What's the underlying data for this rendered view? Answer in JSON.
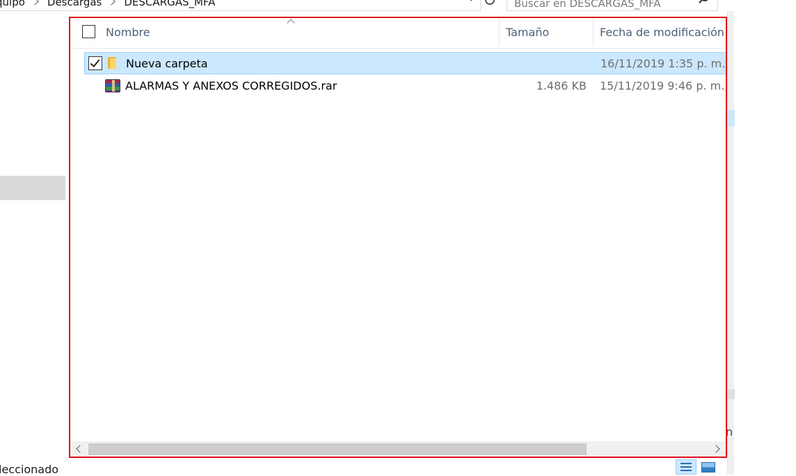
{
  "breadcrumb": {
    "items": [
      "quipo",
      "Descargas",
      "DESCARGAS_MFA"
    ]
  },
  "search": {
    "placeholder": "Buscar en DESCARGAS_MFA"
  },
  "file_list": {
    "columns": {
      "name": "Nombre",
      "size": "Tamaño",
      "modified": "Fecha de modificación"
    },
    "rows": [
      {
        "name": "Nueva carpeta",
        "size": "",
        "modified": "16/11/2019 1:35 p. m.",
        "type_icon": "folder-icon",
        "selected": true,
        "checked": true
      },
      {
        "name": "ALARMAS Y ANEXOS CORREGIDOS.rar",
        "size": "1.486 KB",
        "modified": "15/11/2019 9:46 p. m.",
        "type_icon": "rar-archive-icon",
        "selected": false,
        "checked": false
      }
    ]
  },
  "status_bar": {
    "text": "leccionado"
  },
  "right_edge": {
    "glyph": "n"
  },
  "colors": {
    "selection_bg": "#cce8ff",
    "selection_border": "#99d1ff",
    "frame_highlight": "#e0101a",
    "header_text": "#4c607a",
    "secondary_text": "#6d6d6d"
  }
}
